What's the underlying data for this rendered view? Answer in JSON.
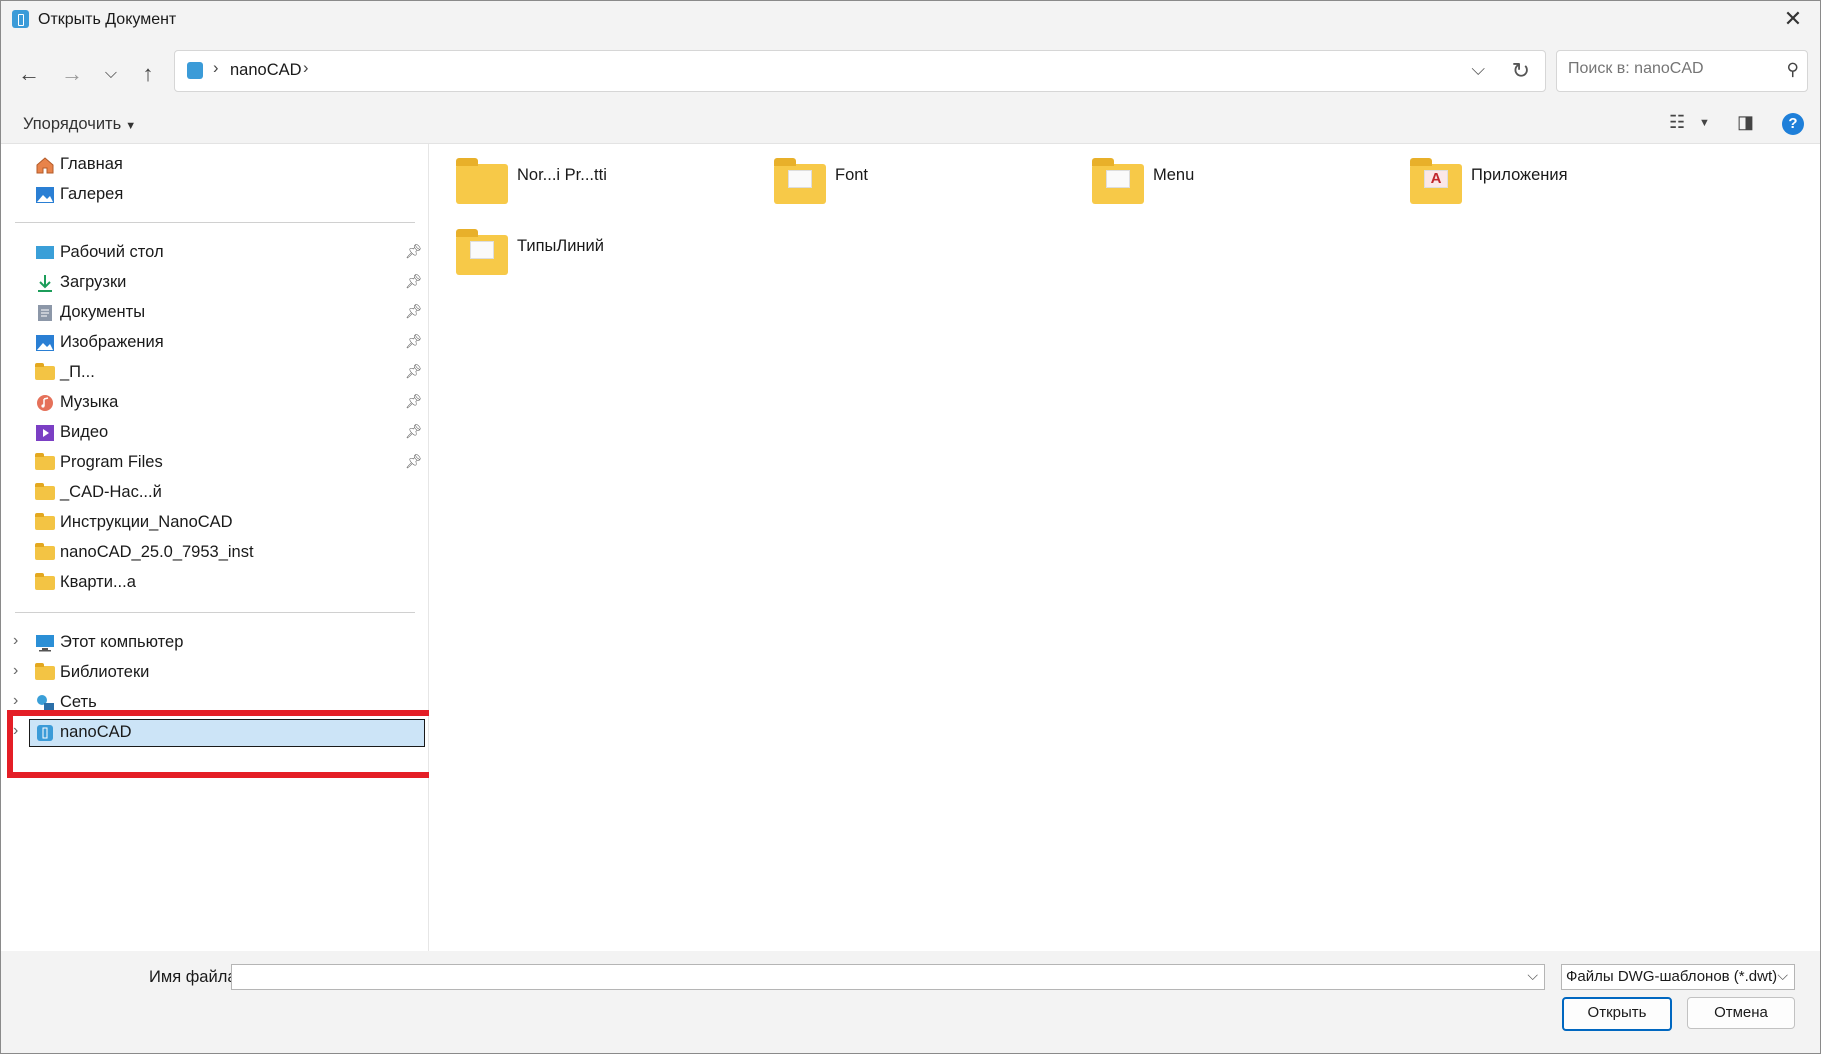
{
  "window": {
    "title": "Открыть Документ"
  },
  "nav_buttons": {
    "back": "←",
    "forward": "→",
    "recent": "⌵",
    "up": "↑"
  },
  "address": {
    "crumb": "nanoCAD"
  },
  "search": {
    "placeholder": "Поиск в: nanoCAD"
  },
  "toolbar": {
    "organize": "Упорядочить"
  },
  "sidebar": {
    "quick": [
      {
        "label": "Главная",
        "icon": "home-icon"
      },
      {
        "label": "Галерея",
        "icon": "gallery-icon"
      }
    ],
    "pinned": [
      {
        "label": "Рабочий стол",
        "icon": "desktop-icon",
        "pinned": true
      },
      {
        "label": "Загрузки",
        "icon": "download-icon",
        "pinned": true
      },
      {
        "label": "Документы",
        "icon": "documents-icon",
        "pinned": true
      },
      {
        "label": "Изображения",
        "icon": "pictures-icon",
        "pinned": true
      },
      {
        "label": "_П...",
        "icon": "folder-icon",
        "pinned": true
      },
      {
        "label": "Музыка",
        "icon": "music-icon",
        "pinned": true
      },
      {
        "label": "Видео",
        "icon": "video-icon",
        "pinned": true
      },
      {
        "label": "Program Files",
        "icon": "folder-icon",
        "pinned": true
      },
      {
        "label": "_CAD-Нас...й",
        "icon": "folder-icon",
        "pinned": false
      },
      {
        "label": "Инструкции_NanoCAD",
        "icon": "folder-icon",
        "pinned": false
      },
      {
        "label": "nanoCAD_25.0_7953_inst",
        "icon": "folder-icon",
        "pinned": false
      },
      {
        "label": "Кварти...а",
        "icon": "folder-icon",
        "pinned": false
      }
    ],
    "tree": [
      {
        "label": "Этот компьютер",
        "icon": "computer-icon"
      },
      {
        "label": "Библиотеки",
        "icon": "libraries-icon"
      },
      {
        "label": "Сеть",
        "icon": "network-icon"
      },
      {
        "label": "nanoCAD",
        "icon": "nanocad-icon",
        "selected": true
      }
    ]
  },
  "folders": [
    {
      "label": "Nor...i Pr...tti",
      "icon": "folder-icon"
    },
    {
      "label": "Font",
      "icon": "folder-doc-icon"
    },
    {
      "label": "Menu",
      "icon": "folder-doc-icon"
    },
    {
      "label": "Приложения",
      "icon": "folder-app-icon"
    },
    {
      "label": "ТипыЛиний",
      "icon": "folder-doc-icon"
    }
  ],
  "footer": {
    "filename_label": "Имя файла:",
    "filename_value": "",
    "filetype": "Файлы DWG-шаблонов (*.dwt)",
    "open": "Открыть",
    "cancel": "Отмена"
  },
  "colors": {
    "highlight": "#e41e26",
    "selection": "#cce4f7",
    "accent": "#0067c0"
  }
}
